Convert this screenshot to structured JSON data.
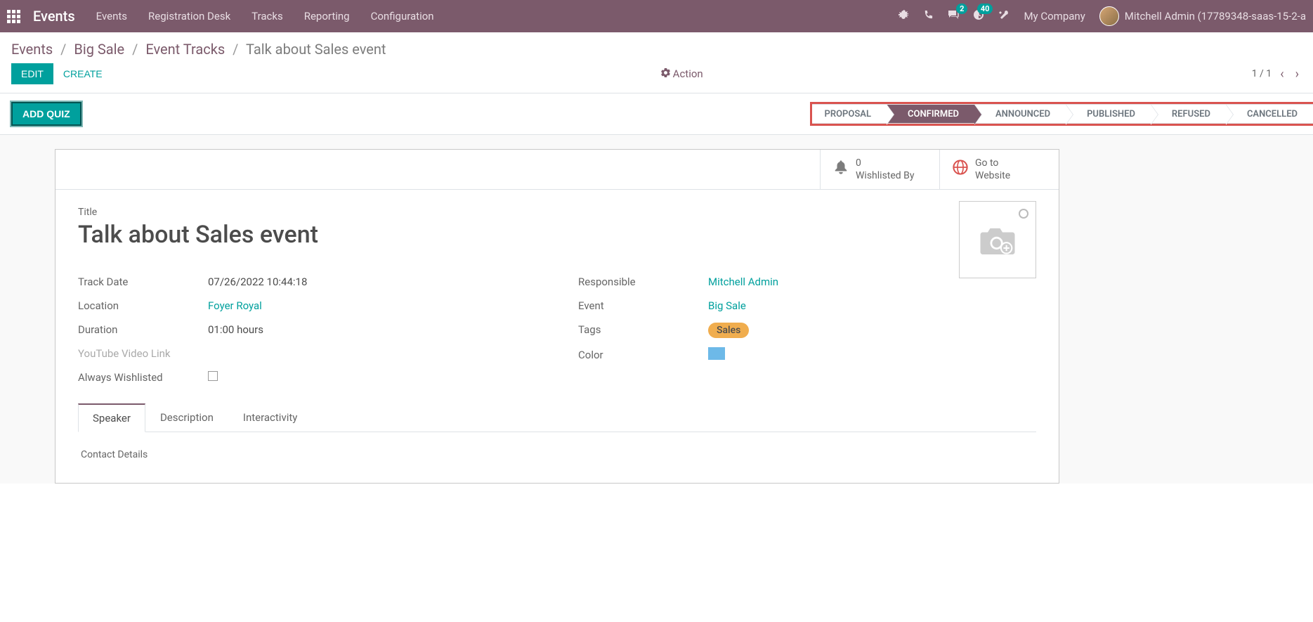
{
  "topbar": {
    "brand": "Events",
    "nav": [
      "Events",
      "Registration Desk",
      "Tracks",
      "Reporting",
      "Configuration"
    ],
    "messages_badge": "2",
    "activities_badge": "40",
    "company": "My Company",
    "user": "Mitchell Admin (17789348-saas-15-2-a"
  },
  "breadcrumb": {
    "items": [
      "Events",
      "Big Sale",
      "Event Tracks"
    ],
    "current": "Talk about Sales event"
  },
  "buttons": {
    "edit": "EDIT",
    "create": "CREATE",
    "action": "Action",
    "add_quiz": "ADD QUIZ"
  },
  "pager": {
    "text": "1 / 1"
  },
  "stages": [
    {
      "label": "PROPOSAL",
      "active": false
    },
    {
      "label": "CONFIRMED",
      "active": true
    },
    {
      "label": "ANNOUNCED",
      "active": false
    },
    {
      "label": "PUBLISHED",
      "active": false
    },
    {
      "label": "REFUSED",
      "active": false
    },
    {
      "label": "CANCELLED",
      "active": false
    }
  ],
  "stat_buttons": {
    "wishlist_count": "0",
    "wishlist_label": "Wishlisted By",
    "website_l1": "Go to",
    "website_l2": "Website"
  },
  "form": {
    "title_label": "Title",
    "title": "Talk about Sales event",
    "left": {
      "track_date_label": "Track Date",
      "track_date": "07/26/2022 10:44:18",
      "location_label": "Location",
      "location": "Foyer Royal",
      "duration_label": "Duration",
      "duration_val": "01:00",
      "duration_unit": "hours",
      "youtube_label": "YouTube Video Link",
      "always_wishlisted_label": "Always Wishlisted"
    },
    "right": {
      "responsible_label": "Responsible",
      "responsible": "Mitchell Admin",
      "event_label": "Event",
      "event": "Big Sale",
      "tags_label": "Tags",
      "tag": "Sales",
      "color_label": "Color"
    }
  },
  "tabs": {
    "items": [
      "Speaker",
      "Description",
      "Interactivity"
    ],
    "active": 0,
    "section": "Contact Details"
  }
}
